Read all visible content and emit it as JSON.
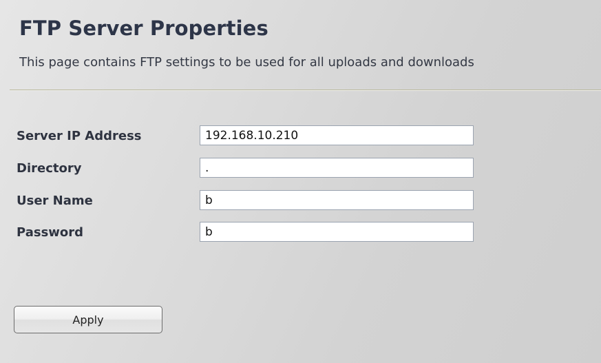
{
  "header": {
    "title": "FTP Server Properties",
    "subtitle": "This page contains FTP settings to be used for all uploads and downloads"
  },
  "form": {
    "fields": [
      {
        "label": "Server IP Address",
        "value": "192.168.10.210"
      },
      {
        "label": "Directory",
        "value": "."
      },
      {
        "label": "User Name",
        "value": "b"
      },
      {
        "label": "Password",
        "value": "b"
      }
    ],
    "apply_label": "Apply"
  },
  "colors": {
    "title": "#2d3548",
    "background": "#d8d8d8",
    "divider": "#b9b89a"
  }
}
